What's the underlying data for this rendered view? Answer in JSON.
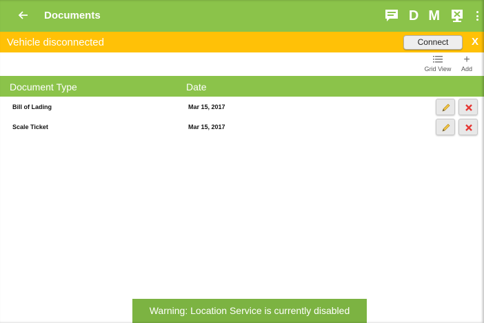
{
  "appbar": {
    "title": "Documents",
    "back_icon": "arrow-left-icon",
    "actions": {
      "messages_icon": "message-icon",
      "d_label": "D",
      "m_label": "M",
      "report_icon": "report-icon",
      "more_icon": "more-vert-icon"
    },
    "color": "#8bc34a"
  },
  "banner": {
    "text": "Vehicle disconnected",
    "connect_label": "Connect",
    "close_label": "X",
    "color": "#ffc107"
  },
  "toolbar": {
    "grid_view_label": "Grid View",
    "add_label": "Add",
    "add_symbol": "+"
  },
  "table": {
    "columns": [
      "Document Type",
      "Date"
    ],
    "rows": [
      {
        "type": "Bill of Lading",
        "date": "Mar 15, 2017"
      },
      {
        "type": "Scale Ticket",
        "date": "Mar 15, 2017"
      }
    ]
  },
  "toast": {
    "text": "Warning: Location Service is currently disabled"
  }
}
